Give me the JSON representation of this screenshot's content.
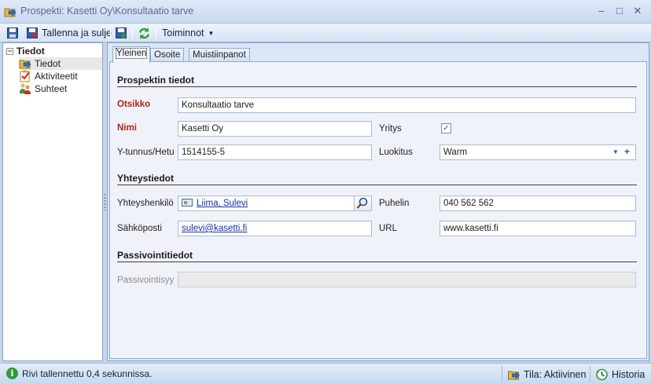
{
  "window": {
    "title": "Prospekti: Kasetti Oy\\Konsultaatio tarve",
    "minimize": "–",
    "maximize": "□",
    "close": "✕"
  },
  "toolbar": {
    "save_close_label": "Tallenna ja sulje",
    "actions_label": "Toiminnot"
  },
  "tree": {
    "root_label": "Tiedot",
    "expander": "−",
    "items": [
      {
        "label": "Tiedot",
        "icon": "prospect-folder-icon",
        "selected": true
      },
      {
        "label": "Aktiviteetit",
        "icon": "activity-checklist-icon",
        "selected": false
      },
      {
        "label": "Suhteet",
        "icon": "relations-people-icon",
        "selected": false
      }
    ]
  },
  "tabs": [
    {
      "label": "Yleinen",
      "active": true
    },
    {
      "label": "Osoite",
      "active": false
    },
    {
      "label": "Muistiinpanot",
      "active": false
    }
  ],
  "form": {
    "section_prospect": "Prospektin tiedot",
    "title_label": "Otsikko",
    "title_value": "Konsultaatio tarve",
    "name_label": "Nimi",
    "name_value": "Kasetti Oy",
    "company_label": "Yritys",
    "company_checked": true,
    "business_id_label": "Y-tunnus/Hetu",
    "business_id_value": "1514155-5",
    "classification_label": "Luokitus",
    "classification_value": "Warm",
    "section_contact": "Yhteystiedot",
    "contact_person_label": "Yhteyshenkilö",
    "contact_person_value": "Liima, Sulevi",
    "phone_label": "Puhelin",
    "phone_value": "040 562 562",
    "email_label": "Sähköposti",
    "email_value": "sulevi@kasetti.fi",
    "url_label": "URL",
    "url_value": "www.kasetti.fi",
    "section_passivation": "Passivointitiedot",
    "passivation_label": "Passivointisyy",
    "passivation_value": ""
  },
  "status": {
    "message": "Rivi tallennettu 0,4 sekunnissa.",
    "state_label": "Tila: Aktiivinen",
    "history_label": "Historia"
  },
  "colors": {
    "required_label": "#b02318",
    "link": "#1b2fa3",
    "accent": "#2a5b9c"
  }
}
